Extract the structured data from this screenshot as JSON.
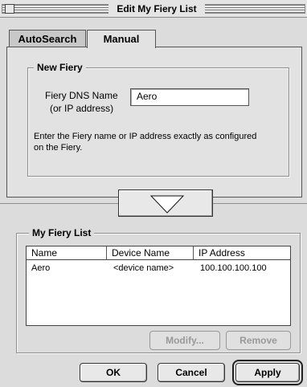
{
  "window": {
    "title": "Edit My Fiery List"
  },
  "tabs": [
    {
      "label": "AutoSearch",
      "active": false
    },
    {
      "label": "Manual",
      "active": true
    }
  ],
  "new_fiery": {
    "group_label": "New Fiery",
    "dns_label_line1": "Fiery DNS Name",
    "dns_label_line2": "(or IP address)",
    "dns_value": "Aero",
    "help_line1": "Enter the Fiery name or IP address exactly as configured",
    "help_line2": "on the Fiery."
  },
  "my_fiery_list": {
    "group_label": "My Fiery List",
    "columns": [
      "Name",
      "Device Name",
      "IP Address"
    ],
    "rows": [
      {
        "name": "Aero",
        "device": "<device name>",
        "ip": "100.100.100.100"
      }
    ],
    "modify_label": "Modify...",
    "remove_label": "Remove"
  },
  "footer": {
    "ok_label": "OK",
    "cancel_label": "Cancel",
    "apply_label": "Apply"
  }
}
